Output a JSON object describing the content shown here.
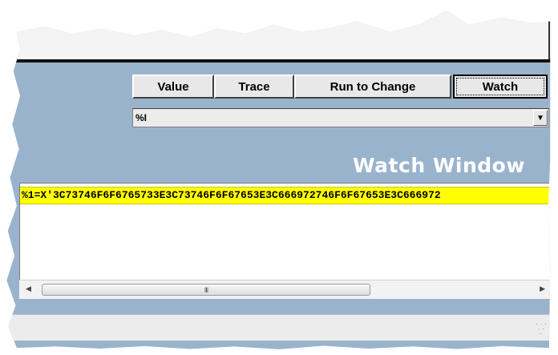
{
  "buttons": {
    "value": "Value",
    "trace": "Trace",
    "run_to_change": "Run to Change",
    "watch": "Watch"
  },
  "variable_select": {
    "selected": "%I"
  },
  "watch_window": {
    "title": "Watch Window",
    "rows": [
      "%1=X'3C73746F6F6765733E3C73746F6F67653E3C666972746F6F67653E3C666972"
    ]
  },
  "scrollbar": {
    "grip": "III"
  },
  "colors": {
    "accent_panel": "#9ab3cd",
    "highlight_row": "#ffff00",
    "title_text": "#ffffff"
  },
  "icons": {
    "dropdown": "chevron-down-icon",
    "scroll_left": "arrow-left-icon",
    "scroll_right": "arrow-right-icon",
    "resize": "resize-grip-icon"
  }
}
